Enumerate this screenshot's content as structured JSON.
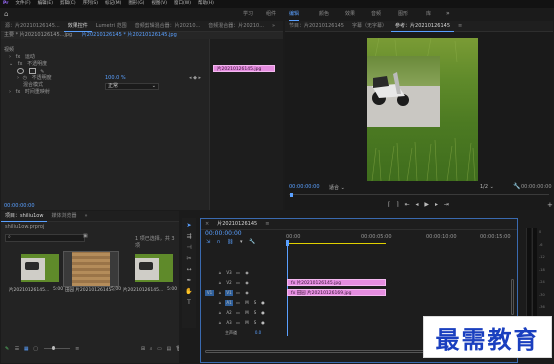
{
  "menubar": {
    "items": [
      "文件(F)",
      "编辑(E)",
      "剪辑(C)",
      "序列(S)",
      "标记(M)",
      "图形(G)",
      "视图(V)",
      "窗口(W)",
      "帮助(H)"
    ]
  },
  "workspaces": {
    "items": [
      "学习",
      "组件",
      "编辑",
      "颜色",
      "效果",
      "音频",
      "图形",
      "库"
    ],
    "active_index": 2
  },
  "effect_controls": {
    "tabs": [
      "源：片20210126145...",
      "效果控件",
      "Lumetri 范围",
      "音频剪辑混合器：片20210...",
      "音频混合器：片20210..."
    ],
    "active_tab": 1,
    "source_label": "主要 * 片20210126145...jpg",
    "target_label": "片20210126145 * 片20210126145.jpg",
    "mini_clip_label": "片20210126145.jpg",
    "section": "视频",
    "rows": [
      {
        "label": "运动",
        "value": ""
      },
      {
        "label": "不透明度",
        "value": ""
      },
      {
        "label": "不透明度",
        "value": "100.0 %"
      },
      {
        "label": "混合模式",
        "value": "正常"
      },
      {
        "label": "时间重映射",
        "value": ""
      }
    ],
    "timecode": "00:00:00:00"
  },
  "program_monitor": {
    "tabs": [
      "节目：片20210126145",
      "字幕（无字幕）",
      "参考：片20210126145"
    ],
    "active_tab": 2,
    "timecode": "00:00:00:00",
    "fit_label": "适合",
    "quality": "1/2",
    "duration": "00:00:00:00"
  },
  "project_panel": {
    "tabs": [
      "项目：shiliu1ow",
      "媒体浏览器"
    ],
    "active_tab": 0,
    "project_file": "shiliu1ow.prproj",
    "status": "1 项已选择，共 3 项",
    "items": [
      {
        "label": "片20210126145...",
        "duration": "5:00"
      },
      {
        "label": "田园 片20210126145...",
        "duration": "5:00"
      },
      {
        "label": "片20210126145...",
        "duration": "5:00"
      }
    ]
  },
  "timeline": {
    "tab": "片20210126145",
    "timecode": "00:00:00:00",
    "ruler": [
      "00:00",
      "00:00:05:00",
      "00:00:10:00",
      "00:00:15:00"
    ],
    "tracks": [
      {
        "label": "V3",
        "src": ""
      },
      {
        "label": "V2",
        "src": ""
      },
      {
        "label": "V1",
        "src": "V1"
      },
      {
        "label": "A1",
        "src": "A1"
      },
      {
        "label": "A2",
        "src": ""
      },
      {
        "label": "A3",
        "src": ""
      }
    ],
    "master_label": "主声道",
    "master_value": "0.0",
    "clips": [
      {
        "label": "片20210126145.jpg",
        "track": "V2"
      },
      {
        "label": "田园 片20210126169.jpg",
        "track": "V1"
      }
    ],
    "vu_labels": [
      "0",
      "-6",
      "-12",
      "-18",
      "-24",
      "-30",
      "-36",
      "-42",
      "-48",
      "-54"
    ]
  },
  "watermark": {
    "text": "最需教育"
  },
  "colors": {
    "accent": "#5aa0ff",
    "clip": "#e58de0",
    "playhead": "#5aa0ff",
    "work_area": "#e0d000"
  }
}
